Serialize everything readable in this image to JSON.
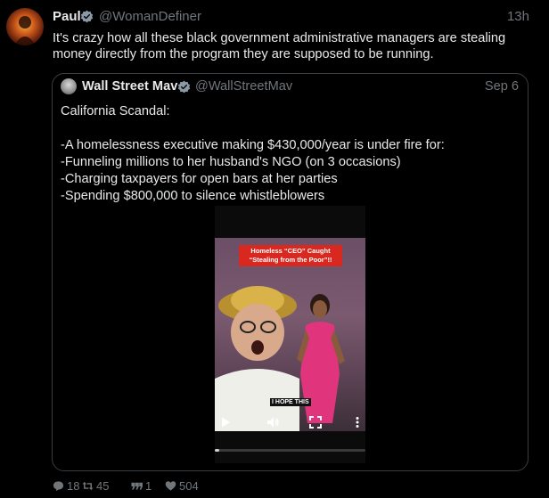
{
  "tweet": {
    "author_name": "Paul",
    "author_handle": "@WomanDefiner",
    "time": "13h",
    "text_lines": [
      "It's crazy how all these black government administrative managers are stealing",
      "money directly from the program they are supposed to be running."
    ]
  },
  "quote": {
    "author_name": "Wall Street Mav",
    "author_handle": "@WallStreetMav",
    "date": "Sep 6",
    "lines": [
      "California Scandal:",
      "",
      "-A homelessness executive making $430,000/year is under fire for:",
      "-Funneling millions to her husband's NGO (on 3 occasions)",
      "-Charging taxpayers for open bars at her parties",
      "-Spending $800,000 to silence whistleblowers"
    ],
    "video": {
      "caption_line1": "Homeless “CEO” Caught",
      "caption_line2": "“Stealing from the Poor”!!",
      "subtitle": "I HOPE THIS",
      "progress": 0.03
    }
  },
  "actions": {
    "replies": "18",
    "retweets": "45",
    "quotes": "1",
    "likes": "504"
  },
  "colors": {
    "background": "#000000",
    "text": "#e7e9ea",
    "muted": "#71767b",
    "verified": "#8b98a5",
    "caption_bg": "#d8281f"
  },
  "icons": {
    "verified": "verified-badge-icon",
    "reply": "reply-icon",
    "retweet": "retweet-icon",
    "quote": "quote-icon",
    "like": "heart-icon",
    "play": "play-icon",
    "volume": "volume-icon",
    "fullscreen": "fullscreen-icon",
    "more": "more-vertical-icon"
  }
}
